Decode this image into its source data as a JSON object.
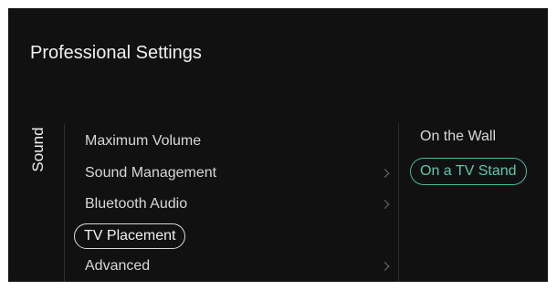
{
  "screen": {
    "title": "Professional Settings",
    "category": "Sound"
  },
  "menu": {
    "items": [
      {
        "label": "Maximum Volume",
        "has_submenu": false,
        "selected": false
      },
      {
        "label": "Sound Management",
        "has_submenu": true,
        "selected": false
      },
      {
        "label": "Bluetooth Audio",
        "has_submenu": true,
        "selected": false
      },
      {
        "label": "TV Placement",
        "has_submenu": false,
        "selected": true
      },
      {
        "label": "Advanced",
        "has_submenu": true,
        "selected": false
      }
    ]
  },
  "options": {
    "items": [
      {
        "label": "On the Wall",
        "selected": false
      },
      {
        "label": "On a TV Stand",
        "selected": true
      }
    ]
  },
  "colors": {
    "background": "#111111",
    "text": "#d8d8d8",
    "accent": "#49b89f"
  },
  "icons": {
    "submenu": "chevron-right-icon"
  }
}
